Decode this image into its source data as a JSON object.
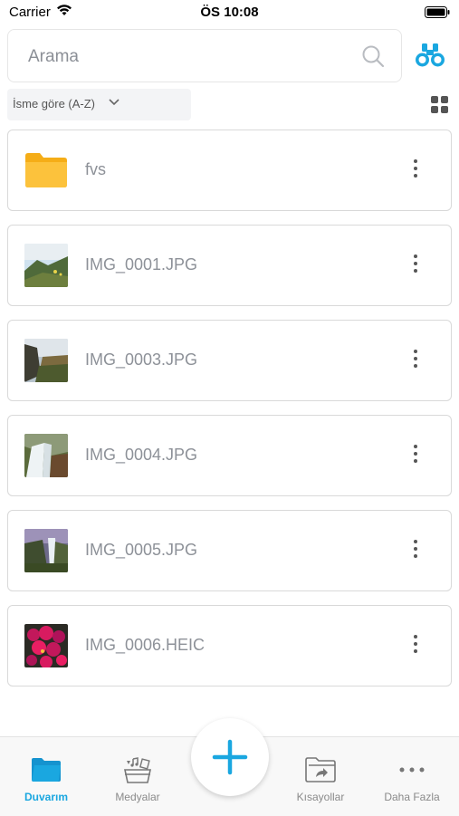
{
  "status_bar": {
    "carrier": "Carrier",
    "time": "ÖS 10:08"
  },
  "search": {
    "placeholder": "Arama",
    "value": ""
  },
  "sort": {
    "label": "İsme göre (A-Z)"
  },
  "files": [
    {
      "name": "fvs",
      "type": "folder",
      "icon": "folder-icon"
    },
    {
      "name": "IMG_0001.JPG",
      "type": "image"
    },
    {
      "name": "IMG_0003.JPG",
      "type": "image"
    },
    {
      "name": "IMG_0004.JPG",
      "type": "image"
    },
    {
      "name": "IMG_0005.JPG",
      "type": "image"
    },
    {
      "name": "IMG_0006.HEIC",
      "type": "image"
    }
  ],
  "tabs": [
    {
      "label": "Duvarım",
      "icon": "folder-icon",
      "active": true
    },
    {
      "label": "Medyalar",
      "icon": "media-icon",
      "active": false
    },
    {
      "label": "Kısayollar",
      "icon": "shortcut-folder-icon",
      "active": false
    },
    {
      "label": "Daha Fazla",
      "icon": "more-horizontal-icon",
      "active": false
    }
  ],
  "colors": {
    "accent": "#1aa7e0",
    "folder": "#fbbd2c",
    "text_muted": "#8d9198"
  }
}
